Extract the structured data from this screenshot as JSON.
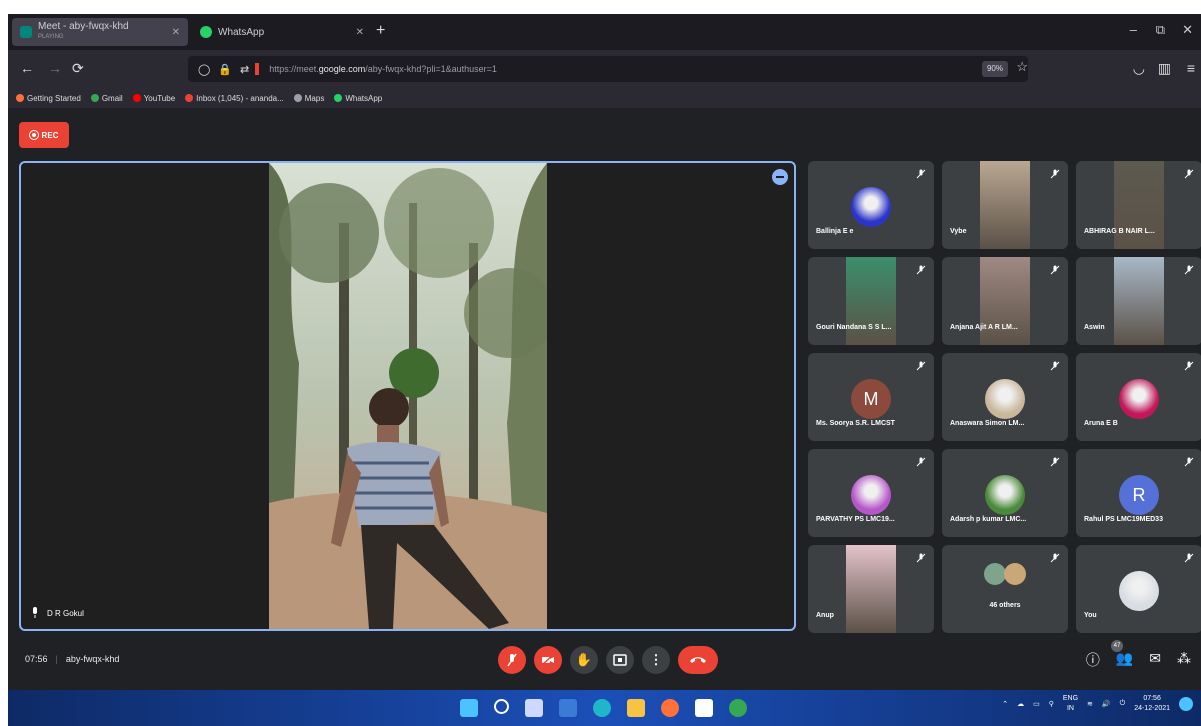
{
  "browser": {
    "tabs": [
      {
        "title": "Meet - aby-fwqx-khd",
        "subtitle": "PLAYING",
        "active": true
      },
      {
        "title": "WhatsApp",
        "active": false
      }
    ],
    "new_tab_symbol": "+",
    "window_controls": [
      "–",
      "⧉",
      "✕"
    ],
    "url_prefix": "https://meet.",
    "url_host": "google.com",
    "url_rest": "/aby-fwqx-khd?pli=1&authuser=1",
    "zoom": "90%",
    "bookmarks": [
      {
        "label": "Getting Started",
        "color": "#ff7139"
      },
      {
        "label": "Gmail",
        "color": "#34a853"
      },
      {
        "label": "YouTube",
        "color": "#ff0000"
      },
      {
        "label": "Inbox (1,045) - ananda...",
        "color": "#ea4335"
      },
      {
        "label": "Maps",
        "color": "#9aa0a6"
      },
      {
        "label": "WhatsApp",
        "color": "#25d366"
      }
    ]
  },
  "meet": {
    "rec_label": "REC",
    "main_speaker": "D R Gokul",
    "time": "07:56",
    "meeting_code": "aby-fwqx-khd",
    "participant_badge": "47",
    "participants": [
      {
        "name": "Ballinja E e",
        "kind": "image",
        "color": "#2b35c9"
      },
      {
        "name": "Vybe",
        "kind": "video",
        "color": "#b9a792"
      },
      {
        "name": "ABHIRAG B NAIR L...",
        "kind": "video",
        "color": "#5d5a4f"
      },
      {
        "name": "Gouri Nandana S S L...",
        "kind": "video",
        "color": "#3b8f6b"
      },
      {
        "name": "Anjana Ajit A R LM...",
        "kind": "video",
        "color": "#9f8a83"
      },
      {
        "name": "Aswin",
        "kind": "video",
        "color": "#a7b8c8"
      },
      {
        "name": "Ms. Soorya S.R. LMCST",
        "kind": "letter",
        "letter": "M",
        "color": "#8b4a3b"
      },
      {
        "name": "Anaswara Simon LM...",
        "kind": "image",
        "color": "#c9b79a"
      },
      {
        "name": "Aruna E B",
        "kind": "image",
        "color": "#c2185b"
      },
      {
        "name": "PARVATHY PS LMC19...",
        "kind": "image",
        "color": "#b657c9"
      },
      {
        "name": "Adarsh p kumar LMC...",
        "kind": "image",
        "color": "#4a8a3a"
      },
      {
        "name": "Rahul PS LMC19MED33",
        "kind": "letter",
        "letter": "R",
        "color": "#5570d6"
      },
      {
        "name": "Anup",
        "kind": "video",
        "color": "#e3c3c9"
      },
      {
        "name": "46 others",
        "kind": "group",
        "color": "#8a9e8a"
      },
      {
        "name": "You",
        "kind": "image",
        "color": "#d8dde3"
      }
    ]
  },
  "taskbar": {
    "icons": [
      {
        "name": "windows-start-icon",
        "color": "#4cc2ff"
      },
      {
        "name": "search-icon",
        "color": "#ffffff"
      },
      {
        "name": "task-view-icon",
        "color": "#cfd8ff"
      },
      {
        "name": "widgets-icon",
        "color": "#3a7bd5"
      },
      {
        "name": "edge-icon",
        "color": "#1fb6c9"
      },
      {
        "name": "file-explorer-icon",
        "color": "#f6c343"
      },
      {
        "name": "firefox-icon",
        "color": "#ff7139"
      },
      {
        "name": "store-icon",
        "color": "#ffffff"
      },
      {
        "name": "chrome-icon",
        "color": "#34a853"
      }
    ],
    "lang_top": "ENG",
    "lang_bottom": "IN",
    "clock_time": "07:56",
    "clock_date": "24-12-2021"
  }
}
